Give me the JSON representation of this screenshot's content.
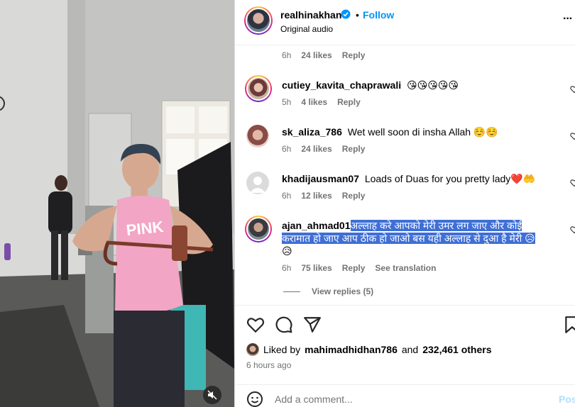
{
  "header": {
    "username": "realhinakhan",
    "follow_label": "Follow",
    "audio": "Original audio",
    "dot": "•",
    "more": "···"
  },
  "top_meta": {
    "time": "6h",
    "likes": "24 likes",
    "reply": "Reply"
  },
  "comments": [
    {
      "username": "cutiey_kavita_chaprawali",
      "text": "😘😘😘😘😘",
      "time": "5h",
      "likes": "4 likes",
      "reply": "Reply"
    },
    {
      "username": "sk_aliza_786",
      "text": "Wet well soon di insha Allah ☺️☺️",
      "time": "6h",
      "likes": "24 likes",
      "reply": "Reply"
    },
    {
      "username": "khadijausman07",
      "text": "Loads of Duas for you pretty lady❤️🤲",
      "time": "6h",
      "likes": "12 likes",
      "reply": "Reply"
    },
    {
      "username": "ajan_ahmad01",
      "text_line1": "अल्लाह करे आपको मेरी उमर लग जाए और कोई",
      "text_line2": "करामात हो जाए आप ठीक हो जाओ बस यही अल्लाह से दुआ है मेरी 😥",
      "text_line3": "😥",
      "time": "6h",
      "likes": "75 likes",
      "reply": "Reply",
      "translation": "See translation"
    }
  ],
  "view_replies": "View replies (5)",
  "likes_summary": {
    "prefix": "Liked by",
    "user": "mahimadhidhan786",
    "joiner": "and",
    "count": "232,461 others"
  },
  "posted_ago": "6 hours ago",
  "comment_input": {
    "placeholder": "Add a comment..."
  },
  "post_label": "Post",
  "colors": {
    "accent": "#0095f6",
    "highlight": "#3f6fd6",
    "muted": "#737373"
  }
}
